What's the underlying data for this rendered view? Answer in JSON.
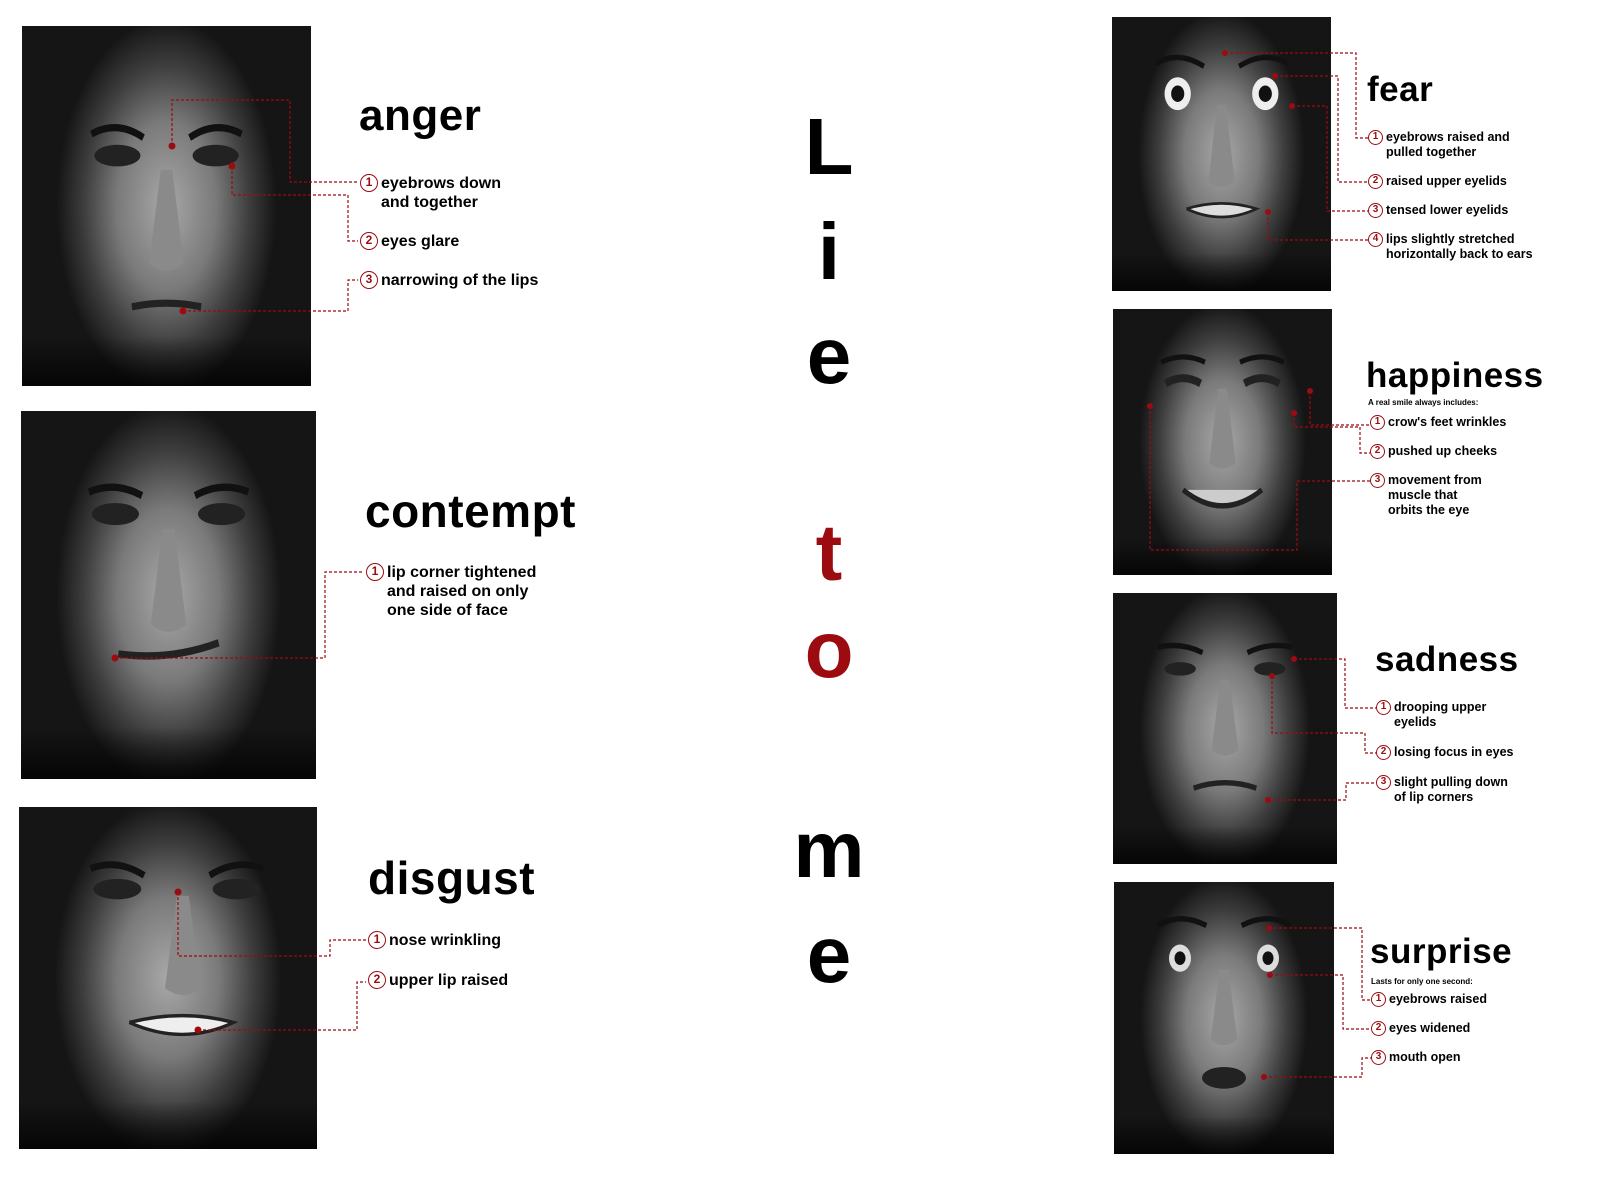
{
  "center_title": {
    "letters": [
      "L",
      "i",
      "e",
      "t",
      "o",
      "m",
      "e"
    ],
    "accent_color": "#9b0b10",
    "text_color": "#000000"
  },
  "marker_color": "#9b0b10",
  "emotions": {
    "anger": {
      "title": "anger",
      "items": [
        {
          "num": "1",
          "text": "eyebrows down and together"
        },
        {
          "num": "2",
          "text": "eyes glare"
        },
        {
          "num": "3",
          "text": "narrowing of the lips"
        }
      ]
    },
    "contempt": {
      "title": "contempt",
      "items": [
        {
          "num": "1",
          "text": "lip corner tightened and raised on only one side of face"
        }
      ]
    },
    "disgust": {
      "title": "disgust",
      "items": [
        {
          "num": "1",
          "text": "nose wrinkling"
        },
        {
          "num": "2",
          "text": "upper lip raised"
        }
      ]
    },
    "fear": {
      "title": "fear",
      "items": [
        {
          "num": "1",
          "text": "eyebrows raised and pulled together"
        },
        {
          "num": "2",
          "text": "raised upper eyelids"
        },
        {
          "num": "3",
          "text": "tensed lower eyelids"
        },
        {
          "num": "4",
          "text": "lips slightly stretched horizontally back to ears"
        }
      ]
    },
    "happiness": {
      "title": "happiness",
      "subtitle": "A real smile always includes:",
      "items": [
        {
          "num": "1",
          "text": "crow's feet wrinkles"
        },
        {
          "num": "2",
          "text": "pushed up cheeks"
        },
        {
          "num": "3",
          "text": "movement from muscle that orbits the eye"
        }
      ]
    },
    "sadness": {
      "title": "sadness",
      "items": [
        {
          "num": "1",
          "text": "drooping upper eyelids"
        },
        {
          "num": "2",
          "text": "losing focus in eyes"
        },
        {
          "num": "3",
          "text": "slight pulling down of lip corners"
        }
      ]
    },
    "surprise": {
      "title": "surprise",
      "subtitle": "Lasts for only one second:",
      "items": [
        {
          "num": "1",
          "text": "eyebrows raised"
        },
        {
          "num": "2",
          "text": "eyes widened"
        },
        {
          "num": "3",
          "text": "mouth open"
        }
      ]
    }
  }
}
